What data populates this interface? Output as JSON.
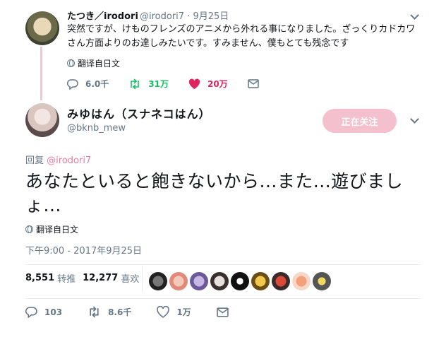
{
  "parent_tweet": {
    "display_name": "たつき／irodori",
    "handle_and_date": "@irodori7 · 9月25日",
    "text": "突然ですが、けものフレンズのアニメから外れる事になりました。ざっくりカドカワさん方面よりのお達しみたいです。すみません、僕もとても残念です",
    "translate_label": "翻译自日文",
    "reply_count": "6.0千",
    "retweet_count": "31万",
    "like_count": "20万"
  },
  "main_tweet": {
    "display_name": "みゆはん（スナネコはん）",
    "handle": "@bknb_mew",
    "follow_button_label": "正在关注",
    "reply_prefix": "回复",
    "reply_to_handle": "@irodori7",
    "text": "あなたといると飽きないから...また...遊びましょ...",
    "translate_label": "翻译自日文",
    "timestamp": "下午9:00 - 2017年9月25日",
    "retweets_count": "8,551",
    "retweets_label": "转推",
    "likes_count": "12,277",
    "likes_label": "喜欢",
    "reply_count": "103",
    "retweet_count": "8.6千",
    "like_count": "1万"
  },
  "colors": {
    "accent_pink": "#e0245e",
    "retweet_green": "#17bf63",
    "follow_button_bg": "#f5c0cd",
    "thread_line": "#f5c6d0",
    "muted": "#657786"
  }
}
